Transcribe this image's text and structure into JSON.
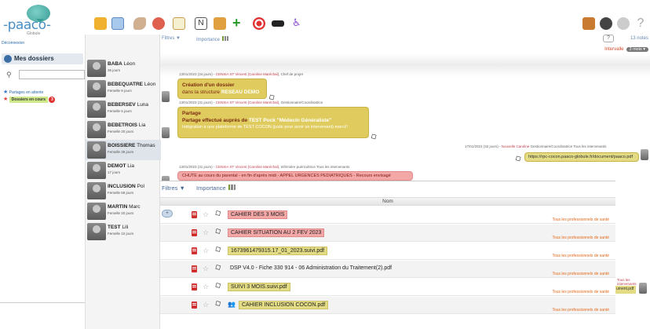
{
  "brand": {
    "name": "-paaco-",
    "sub": "Globule"
  },
  "toolbar": {
    "icons": [
      "folder-icon",
      "chat-icon",
      "shoe-icon",
      "pill-icon",
      "document-icon",
      "n-icon",
      "calendar-icon",
      "plus-icon",
      "target-icon",
      "graduation-icon",
      "wheelchair-icon"
    ],
    "right_icons": [
      "briefcase-icon",
      "camera-icon",
      "settings-icon",
      "help-icon"
    ],
    "help_label": "?"
  },
  "sidebar": {
    "logout": "Déconnexion",
    "my_folders": "Mes dossiers",
    "search_placeholder": "",
    "shared_pending": "Partages en attente",
    "in_progress": "Dossiers en cours",
    "in_progress_count": "3"
  },
  "patients": [
    {
      "last": "BABA",
      "first": "Léon",
      "age": "36 jours"
    },
    {
      "last": "BEBEQUATRE",
      "first": "Léon",
      "age": "Femelle 9 jours"
    },
    {
      "last": "BEBERSEV",
      "first": "Luna",
      "age": "Femelle 5 jours"
    },
    {
      "last": "BEBETROIS",
      "first": "Lia",
      "age": "Femelle 20 jours"
    },
    {
      "last": "BOISSIERE",
      "first": "Thomas",
      "age": "Femelle 39 jours"
    },
    {
      "last": "DEMOT",
      "first": "Lia",
      "age": "17 jours"
    },
    {
      "last": "INCLUSION",
      "first": "Pol",
      "age": "Femelle 58 jours"
    },
    {
      "last": "MARTIN",
      "first": "Marc",
      "age": "Femelle 20 jours"
    },
    {
      "last": "TEST",
      "first": "Lili",
      "age": "Femelle 10 jours"
    }
  ],
  "timeline": {
    "filters": "Filtres ▼",
    "importance": "Importance",
    "help": "?",
    "count": "13 notes",
    "interval_label": "Intervalle",
    "interval_value": "3 mois ▾",
    "entries": [
      {
        "meta_date": "13/01/2023 (34 jours) - ",
        "meta_link": "CENSIA ST Vincent (Caroline Maréchal)",
        "meta_rest": ", Chef de projet",
        "line1": "Création d'un dossier",
        "line2_pre": "dans la structure ",
        "line2_bold": "RESEAU DEMO"
      },
      {
        "meta_date": "13/01/2023 (31 jours) - ",
        "meta_link": "CENSIA ST Vincent (Caroline Maréchal)",
        "meta_rest": ", Gestionnaire/Coordinatrice",
        "title": "Partage",
        "line2_pre": "Partage effectué auprès de ",
        "line2_bold": "TEST Pock \"Médecin Généraliste\"",
        "line3": "Intégration à une plateforme de TEST COCON (juste pour avoir un intervenant) merci!!"
      },
      {
        "meta_date": "17/01/2023 (32 jours) - ",
        "meta_link": "Nouvelle Caroline",
        "meta_rest": " Gestionnaire/Coordinatrice  Tous les intervenants",
        "link": "https://rpc-cocon.paaco-globule.fr/document/paaco.pdf"
      },
      {
        "meta_date": "13/01/2023 (31 jours) - ",
        "meta_link": "CENSIA ST Vincent (Caroline Maréchal)",
        "meta_rest": ", Infirmière puéricultrice   Tous les intervenants",
        "line1": "CHUTE au cours du parental - en fin d'après midi - APPEL URGENCES PEDIATRIQUES - Recours envisagé"
      }
    ]
  },
  "documents": {
    "filters": "Filtres ▼",
    "importance": "Importance",
    "column": "Nom",
    "add": "+",
    "side_label": "Tous les intervenants",
    "side_link": "ument.pdf",
    "rows": [
      {
        "name": "CAHIER DES 3 MOIS",
        "style": "red",
        "who": "Tous les professionnels de santé"
      },
      {
        "name": "CAHIER SITUATION AU 2 FEV 2023",
        "style": "red",
        "who": "Tous les professionnels de santé"
      },
      {
        "name": "1673961479315.17_01_2023.suivi.pdf",
        "style": "yel",
        "who": "Tous les professionnels de santé"
      },
      {
        "name": "DSP V4.0 - Fiche 330 914 - 06 Administration du Traitement(2).pdf",
        "style": "none",
        "who": "Tous les professionnels de santé"
      },
      {
        "name": "SUIVI 3 MOIS.suivi.pdf",
        "style": "yel",
        "who": "Tous les professionnels de santé"
      },
      {
        "name": "CAHIER INCLUSION COCON.pdf",
        "style": "yel",
        "group": true,
        "who": "Tous les professionnels de santé"
      }
    ]
  },
  "colors": {
    "accent": "#4a8fc4",
    "note_yellow": "#e0cc5e",
    "note_red": "#f4a7a7",
    "link_yellow": "#e3dc84",
    "who_orange": "#e36a1a"
  }
}
